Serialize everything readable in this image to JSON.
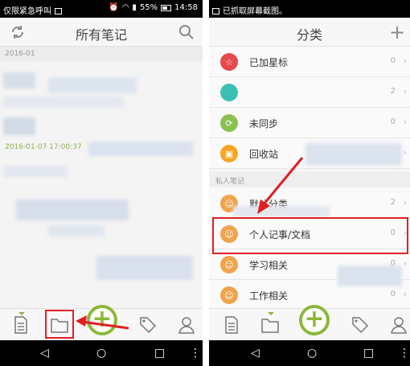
{
  "left_screen": {
    "status": {
      "carrier": "仅限紧急呼叫",
      "battery": "55%",
      "time": "14:58"
    },
    "title": "所有笔记",
    "date_header": "2016-01",
    "note_time": "2016-01-07 17:00:37",
    "accent_color": "#8cb83a"
  },
  "right_screen": {
    "status": {
      "notification": "已抓取屏幕截图。"
    },
    "title": "分类",
    "categories": [
      {
        "label": "已加星标",
        "count": "0",
        "icon": "star-icon",
        "color": "#e5484d"
      },
      {
        "label": "",
        "count": "2",
        "icon": "teal-circle-icon",
        "color": "#3bbfb4"
      },
      {
        "label": "未同步",
        "count": "0",
        "icon": "sync-icon",
        "color": "#8cc152"
      },
      {
        "label": "回收站",
        "count": "0",
        "icon": "trash-icon",
        "color": "#f6a623"
      }
    ],
    "section_label": "私人笔记",
    "personal": [
      {
        "label": "默认分类",
        "count": "2",
        "icon": "person-icon",
        "color": "#f0a44c"
      },
      {
        "label": "个人记事/文档",
        "count": "0",
        "icon": "person-icon",
        "color": "#f0a44c"
      },
      {
        "label": "学习相关",
        "count": "0",
        "icon": "person-icon",
        "color": "#f0a44c"
      },
      {
        "label": "工作相关",
        "count": "0",
        "icon": "person-icon",
        "color": "#f0a44c"
      }
    ]
  }
}
